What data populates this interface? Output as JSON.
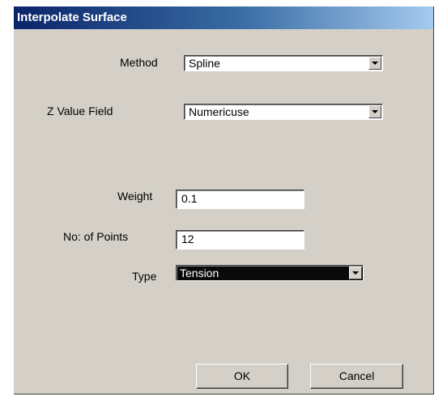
{
  "window": {
    "title": "Interpolate Surface"
  },
  "fields": {
    "method": {
      "label": "Method",
      "value": "Spline"
    },
    "z_value_field": {
      "label": "Z Value Field",
      "value": "Numericuse"
    },
    "weight": {
      "label": "Weight",
      "value": "0.1"
    },
    "no_of_points": {
      "label": "No: of Points",
      "value": "12"
    },
    "type": {
      "label": "Type",
      "value": "Tension"
    }
  },
  "buttons": {
    "ok": "OK",
    "cancel": "Cancel"
  },
  "colors": {
    "title_bar": "#0a246a",
    "dialog_bg": "#d4d0c8",
    "selection": "#0a0a0a"
  },
  "icons": {
    "dropdown": "chevron-down-icon"
  }
}
